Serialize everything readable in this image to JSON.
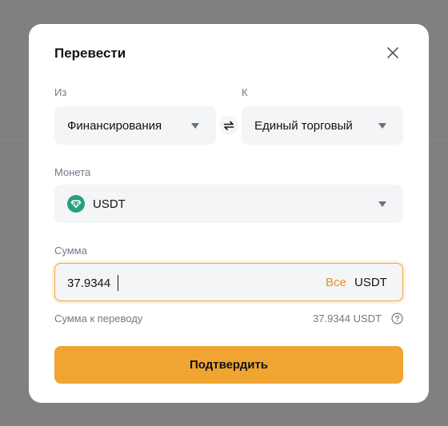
{
  "modal": {
    "title": "Перевести",
    "from_label": "Из",
    "from_value": "Финансирования",
    "to_label": "К",
    "to_value": "Единый торговый",
    "coin_label": "Монета",
    "coin_value": "USDT",
    "amount_label": "Сумма",
    "amount_value": "37.9344",
    "all_label": "Все",
    "amount_unit": "USDT",
    "transfer_label": "Сумма к переводу",
    "transfer_value": "37.9344 USDT",
    "confirm_label": "Подтвердить"
  },
  "icons": {
    "close": "close-icon",
    "swap": "swap-arrows-icon",
    "coin": "usdt-tether-icon",
    "info": "question-circle-icon",
    "caret": "caret-down-icon"
  },
  "colors": {
    "accent": "#f0a432",
    "accent_text": "#e0942c",
    "coin": "#26a17b",
    "overlay": "#808080"
  }
}
